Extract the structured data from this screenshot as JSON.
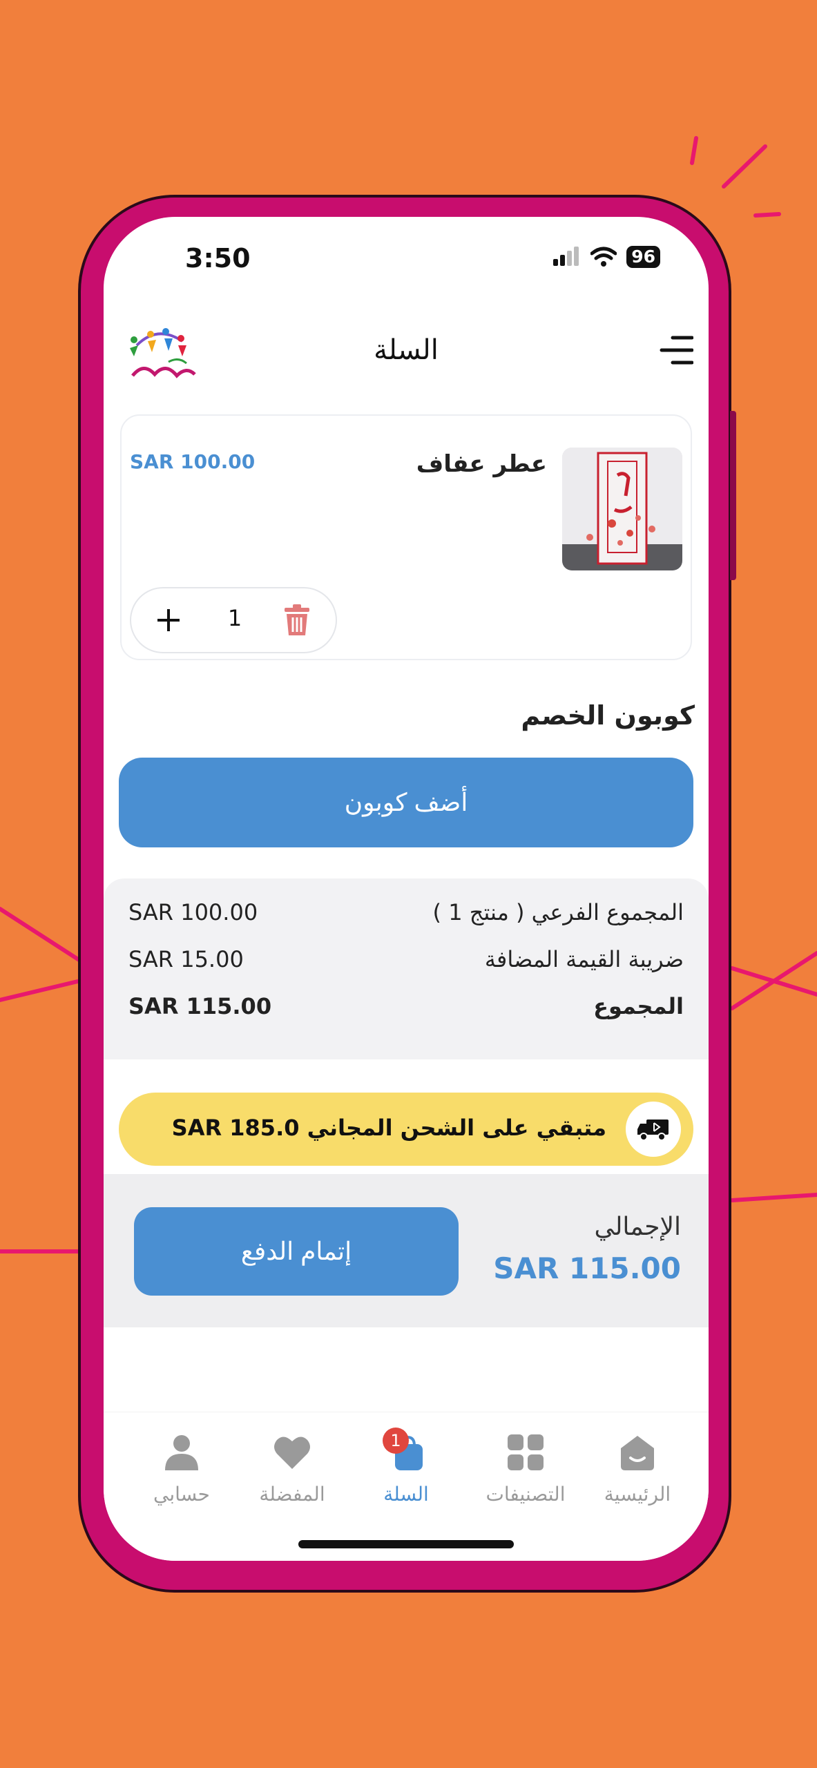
{
  "status_bar": {
    "time": "3:50",
    "battery": "96"
  },
  "header": {
    "title": "السلة"
  },
  "cart_item": {
    "name": "عطر عفاف",
    "price": "SAR 100.00",
    "quantity": "1"
  },
  "coupon": {
    "title": "كوبون الخصم",
    "button_label": "أضف كوبون"
  },
  "summary": {
    "subtotal_label": "المجموع الفرعي ( منتج 1 )",
    "subtotal_value": "SAR 100.00",
    "vat_label": "ضريبة القيمة المضافة",
    "vat_value": "SAR 15.00",
    "total_label": "المجموع",
    "total_value": "SAR 115.00"
  },
  "free_shipping": {
    "text": "متبقي على الشحن المجاني SAR 185.0"
  },
  "checkout": {
    "total_label": "الإجمالي",
    "total_value": "SAR 115.00",
    "button_label": "إتمام الدفع"
  },
  "tabs": [
    {
      "label": "الرئيسية",
      "icon": "home-icon"
    },
    {
      "label": "التصنيفات",
      "icon": "categories-icon"
    },
    {
      "label": "السلة",
      "icon": "cart-bag-icon",
      "badge": "1",
      "active": true
    },
    {
      "label": "المفضلة",
      "icon": "heart-icon"
    },
    {
      "label": "حسابي",
      "icon": "user-icon"
    }
  ],
  "colors": {
    "background": "#F17F3C",
    "phone_frame": "#C80D6E",
    "accent": "#4A8FD2",
    "free_shipping_bg": "#F8DC6A",
    "badge": "#E0463E"
  }
}
